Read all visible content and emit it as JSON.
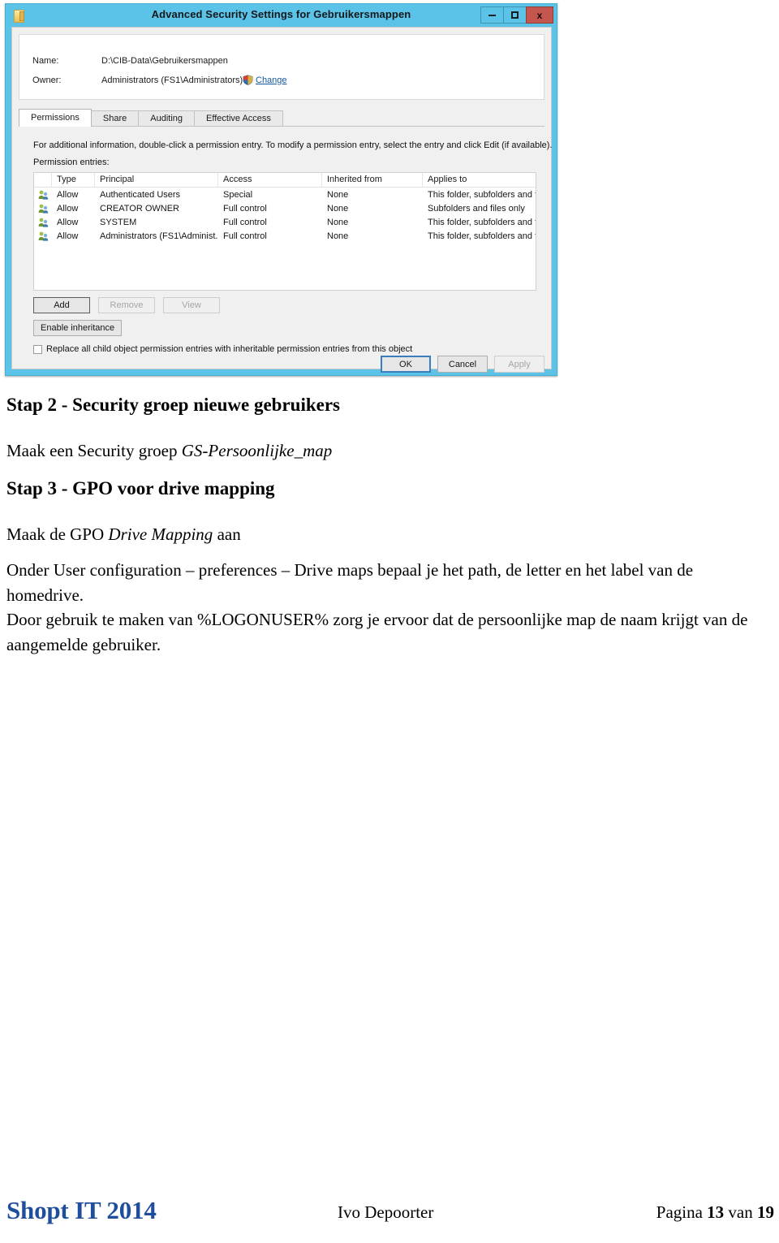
{
  "dialog": {
    "title": "Advanced Security Settings for Gebruikersmappen",
    "icon": "folder-icon",
    "window_buttons": {
      "minimize": "minimize-icon",
      "maximize": "maximize-icon",
      "close": "x"
    },
    "fields": {
      "name_label": "Name:",
      "name_value": "D:\\CIB-Data\\Gebruikersmappen",
      "owner_label": "Owner:",
      "owner_value": "Administrators (FS1\\Administrators)",
      "change_link": "Change"
    },
    "tabs": [
      {
        "label": "Permissions",
        "active": true
      },
      {
        "label": "Share",
        "active": false
      },
      {
        "label": "Auditing",
        "active": false
      },
      {
        "label": "Effective Access",
        "active": false
      }
    ],
    "info_text": "For additional information, double-click a permission entry. To modify a permission entry, select the entry and click Edit (if available).",
    "entries_label": "Permission entries:",
    "table": {
      "columns": [
        "",
        "Type",
        "Principal",
        "Access",
        "Inherited from",
        "Applies to"
      ],
      "rows": [
        {
          "icon": "users-icon",
          "type": "Allow",
          "principal": "Authenticated Users",
          "access": "Special",
          "inherited_from": "None",
          "applies_to": "This folder, subfolders and files"
        },
        {
          "icon": "users-icon",
          "type": "Allow",
          "principal": "CREATOR OWNER",
          "access": "Full control",
          "inherited_from": "None",
          "applies_to": "Subfolders and files only"
        },
        {
          "icon": "users-icon",
          "type": "Allow",
          "principal": "SYSTEM",
          "access": "Full control",
          "inherited_from": "None",
          "applies_to": "This folder, subfolders and files"
        },
        {
          "icon": "users-icon",
          "type": "Allow",
          "principal": "Administrators (FS1\\Administ...",
          "access": "Full control",
          "inherited_from": "None",
          "applies_to": "This folder, subfolders and files"
        }
      ]
    },
    "buttons": {
      "add": "Add",
      "remove": "Remove",
      "view": "View",
      "enable_inheritance": "Enable inheritance",
      "ok": "OK",
      "cancel": "Cancel",
      "apply": "Apply"
    },
    "checkbox": {
      "label": "Replace all child object permission entries with inheritable permission entries from this object",
      "checked": false
    }
  },
  "document": {
    "heading_step2": "Stap 2 - Security groep nieuwe gebruikers",
    "para_security_group_prefix": "Maak een Security groep ",
    "para_security_group_italic": "GS-Persoonlijke_map",
    "heading_step3": "Stap 3 - GPO voor drive mapping",
    "para_gpo_prefix": "Maak de GPO ",
    "para_gpo_italic": "Drive Mapping",
    "para_gpo_suffix": " aan",
    "para_config": "Onder User configuration – preferences – Drive maps bepaal je het path, de letter en het label van de homedrive.",
    "para_logonuser": "Door gebruik te maken van %LOGONUSER% zorg je ervoor dat de persoonlijke map de naam krijgt van de aangemelde gebruiker."
  },
  "footer": {
    "brand": "Shopt IT 2014",
    "author": "Ivo Depoorter",
    "page_prefix": "Pagina ",
    "page_current": "13",
    "page_middle": " van ",
    "page_total": "19"
  },
  "colors": {
    "window_chrome": "#5bc3e8",
    "close_button": "#c4564f",
    "link": "#12579b",
    "brand": "#1f4e9c"
  }
}
